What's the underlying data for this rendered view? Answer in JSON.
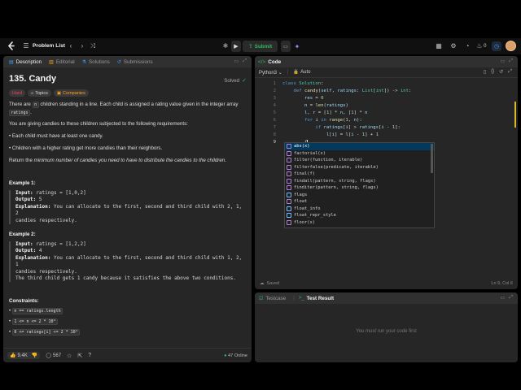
{
  "topbar": {
    "problem_list": "Problem List",
    "submit": "Submit",
    "streak": "0"
  },
  "left": {
    "tabs": [
      "Description",
      "Editorial",
      "Solutions",
      "Submissions"
    ],
    "title": "135. Candy",
    "solved": "Solved",
    "tags": [
      "Hard",
      "Topics",
      "Companies"
    ],
    "p1a": "There are",
    "p1n": "n",
    "p1b": "children standing in a line. Each child is assigned a rating value given in the integer array",
    "p1c": "ratings",
    "p1d": ".",
    "p2": "You are giving candies to these children subjected to the following requirements:",
    "bullets": [
      "Each child must have at least one candy.",
      "Children with a higher rating get more candies than their neighbors."
    ],
    "p3a": "Return the",
    "p3b": "minimum number of candies you need to have to distribute the candies to the children",
    "p3c": ".",
    "ex1": {
      "heading": "Example 1:",
      "input_l": "Input:",
      "input": "ratings = [1,0,2]",
      "output_l": "Output:",
      "output": "5",
      "expl_l": "Explanation:",
      "expl1": "You can allocate to the first, second and third child with 2, 1, 2",
      "expl2": "candies respectively."
    },
    "ex2": {
      "heading": "Example 2:",
      "input_l": "Input:",
      "input": "ratings = [1,2,2]",
      "output_l": "Output:",
      "output": "4",
      "expl_l": "Explanation:",
      "expl1": "You can allocate to the first, second and third child with 1, 2, 1",
      "expl2": "candies respectively.",
      "expl3": "The third child gets 1 candy because it satisfies the above two conditions."
    },
    "constraints": {
      "heading": "Constraints:",
      "c1": "n == ratings.length",
      "c2": "1 <= n <= 2 * 10⁴",
      "c3": "0 <= ratings[i] <= 2 * 10⁴"
    },
    "footer": {
      "likes": "9.4K",
      "comments": "567",
      "online": "47 Online"
    }
  },
  "code": {
    "title": "Code",
    "lang": "Python3",
    "auto": "Auto",
    "line_numbers": [
      "1",
      "2",
      "3",
      "4",
      "5",
      "6",
      "7",
      "8",
      "9"
    ],
    "status_left": "Saved",
    "status_right": "Ln 9, Col 6"
  },
  "autocomplete": [
    "abs(x)",
    "factorial(x)",
    "filter(function, iterable)",
    "filterfalse(predicate, iterable)",
    "final(f)",
    "findall(pattern, string, flags)",
    "finditer(pattern, string, flags)",
    "flags",
    "float",
    "float_info",
    "float_repr_style",
    "floor(x)"
  ],
  "test": {
    "tab1": "Testcase",
    "tab2": "Test Result",
    "message": "You must run your code first"
  },
  "colors": {
    "accent_green": "#2cbb5d",
    "hard_red": "#ff375f",
    "brand_orange": "#ffa116"
  }
}
